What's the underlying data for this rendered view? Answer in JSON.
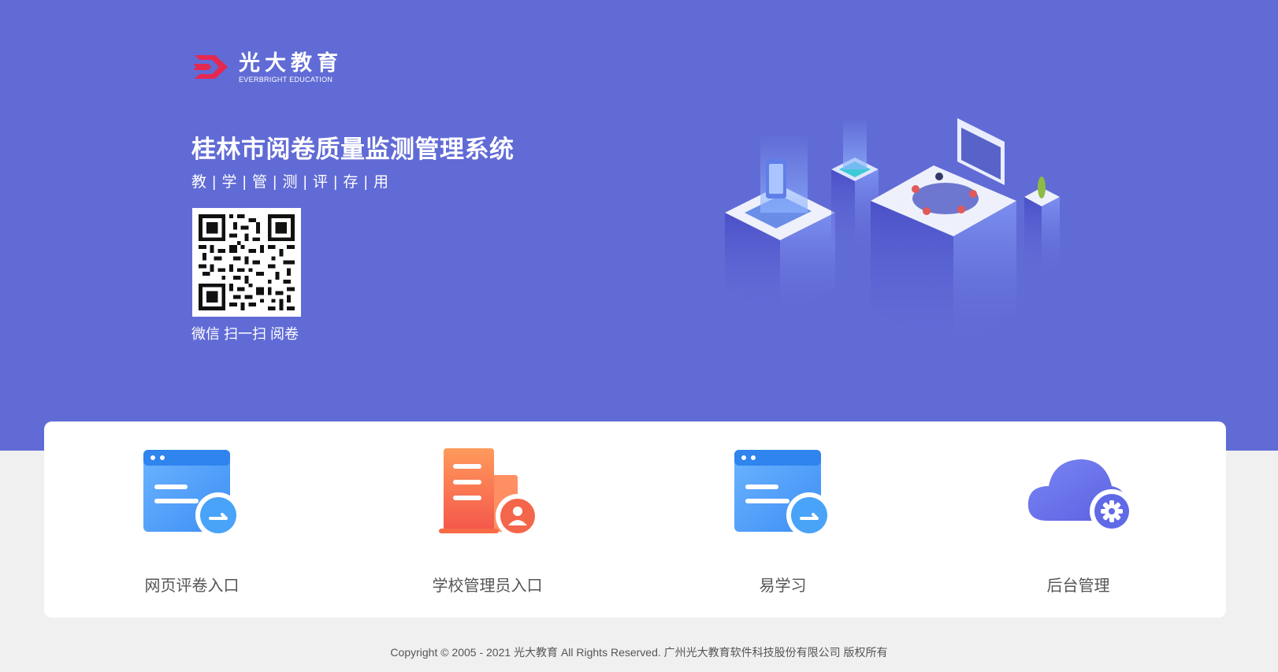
{
  "brand": {
    "name_cn": "光大教育",
    "name_en": "EVERBRIGHT EDUCATION"
  },
  "hero": {
    "title": "桂林市阅卷质量监测管理系统",
    "subtitle": "教 | 学 | 管 | 测 | 评 | 存 | 用",
    "qr_caption": "微信 扫一扫 阅卷"
  },
  "entries": [
    {
      "label": "网页评卷入口",
      "icon": "browser-arrow-icon"
    },
    {
      "label": "学校管理员入口",
      "icon": "building-user-icon"
    },
    {
      "label": "易学习",
      "icon": "browser-arrow-icon"
    },
    {
      "label": "后台管理",
      "icon": "cloud-gear-icon"
    }
  ],
  "footer": {
    "copyright": "Copyright © 2005 - 2021 光大教育 All Rights Reserved. 广州光大教育软件科技股份有限公司 版权所有"
  },
  "colors": {
    "hero_bg": "#616bd6",
    "page_bg": "#f0f0f0",
    "brand_red": "#e5284f"
  }
}
